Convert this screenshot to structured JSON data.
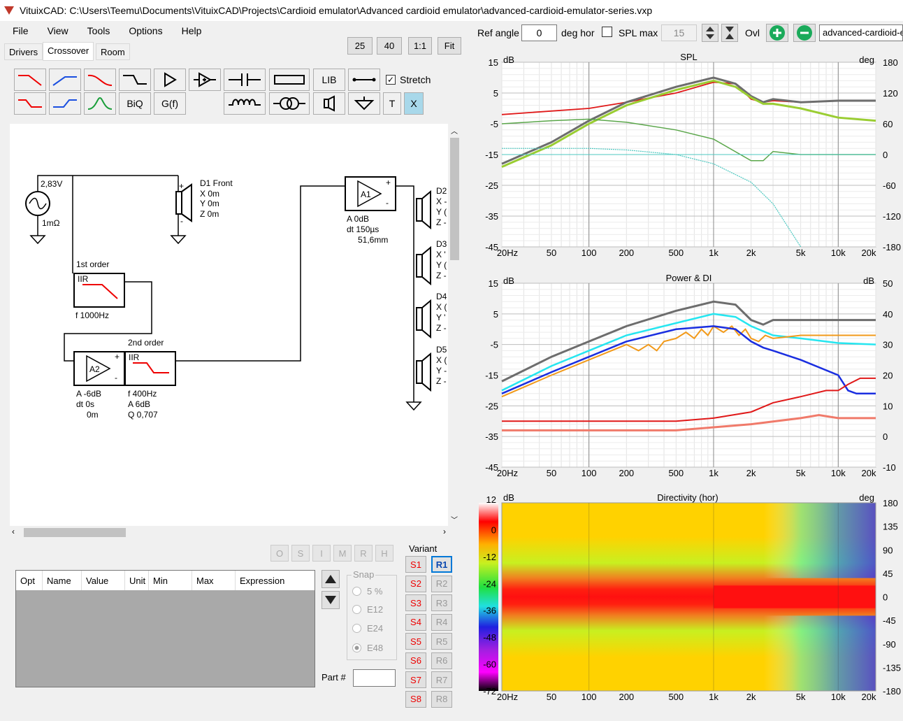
{
  "window": {
    "title": "VituixCAD: C:\\Users\\Teemu\\Documents\\VituixCAD\\Projects\\Cardioid emulator\\Advanced cardioid emulator\\advanced-cardioid-emulator-series.vxp"
  },
  "menu": [
    "File",
    "View",
    "Tools",
    "Options",
    "Help"
  ],
  "tabs": [
    "Drivers",
    "Crossover",
    "Room"
  ],
  "zoom": [
    "25",
    "40",
    "1:1",
    "Fit"
  ],
  "toolbar": {
    "lib": "LIB",
    "biq": "BiQ",
    "gf": "G(f)",
    "t": "T",
    "x": "X",
    "stretch": "Stretch"
  },
  "top": {
    "ref_angle_label": "Ref angle",
    "ref_angle": "0",
    "deg_hor": "deg hor",
    "spl_max": "SPL max",
    "spl_max_val": "15",
    "ovl": "Ovl",
    "ovl_file": "advanced-cardioid-e"
  },
  "schematic": {
    "source_v": "2,83V",
    "source_r": "1mΩ",
    "d1": [
      "D1 Front",
      "X 0m",
      "Y 0m",
      "Z 0m"
    ],
    "a1": {
      "label": "A1",
      "info": [
        "A  0dB",
        "dt 150µs",
        "51,6mm"
      ]
    },
    "iir1": {
      "title": "1st order",
      "tag": "IIR",
      "info": "f  1000Hz"
    },
    "a2": {
      "label": "A2",
      "info": [
        "A  -6dB",
        "dt 0s",
        "0m"
      ]
    },
    "iir2": {
      "title": "2nd order",
      "tag": "IIR",
      "info": [
        "f  400Hz",
        "A  6dB",
        "Q  0,707"
      ]
    },
    "drivers": [
      {
        "name": "D2",
        "l": [
          "X -",
          "Y (",
          "Z -"
        ]
      },
      {
        "name": "D3",
        "l": [
          "X '",
          "Y (",
          "Z -"
        ]
      },
      {
        "name": "D4",
        "l": [
          "X (",
          "Y '",
          "Z -"
        ]
      },
      {
        "name": "D5",
        "l": [
          "X (",
          "Y -",
          "Z -"
        ]
      }
    ]
  },
  "opt_buttons": [
    "O",
    "S",
    "I",
    "M",
    "R",
    "H"
  ],
  "param_headers": [
    "Opt",
    "Name",
    "Value",
    "Unit",
    "Min",
    "Max",
    "Expression"
  ],
  "snap": {
    "label": "Snap",
    "opts": [
      "5 %",
      "E12",
      "E24",
      "E48"
    ]
  },
  "part_label": "Part #",
  "variant": {
    "label": "Variant",
    "s": [
      "S1",
      "S2",
      "S3",
      "S4",
      "S5",
      "S6",
      "S7",
      "S8"
    ],
    "r": [
      "R1",
      "R2",
      "R3",
      "R4",
      "R5",
      "R6",
      "R7",
      "R8"
    ]
  },
  "x_ticks": [
    "20Hz",
    "50",
    "100",
    "200",
    "500",
    "1k",
    "2k",
    "5k",
    "10k",
    "20k"
  ],
  "spl": {
    "title": "SPL",
    "yl": "dB",
    "yr": "deg",
    "left": [
      "15",
      "5",
      "-5",
      "-15",
      "-25",
      "-35",
      "-45"
    ],
    "right": [
      "180",
      "120",
      "60",
      "0",
      "-60",
      "-120",
      "-180"
    ]
  },
  "power": {
    "title": "Power & DI",
    "yl": "dB",
    "yr": "dB",
    "left": [
      "15",
      "5",
      "-5",
      "-15",
      "-25",
      "-35",
      "-45"
    ],
    "right": [
      "50",
      "40",
      "30",
      "20",
      "10",
      "0",
      "-10"
    ]
  },
  "dir": {
    "title": "Directivity (hor)",
    "yl": "dB",
    "yr": "deg",
    "scale": [
      "12",
      "0",
      "-12",
      "-24",
      "-36",
      "-48",
      "-60",
      "-72"
    ],
    "right": [
      "180",
      "135",
      "90",
      "45",
      "0",
      "-45",
      "-90",
      "-135",
      "-180"
    ]
  },
  "colors": {
    "gray": "#6d6d6d",
    "red": "#e01818",
    "lime": "#9acd32",
    "green": "#5aa64a",
    "teal": "#4cc8c0",
    "cyan": "#26e6f0",
    "blue": "#1a2ee0",
    "orange": "#f29a1a",
    "salmon": "#f07a6a"
  }
}
